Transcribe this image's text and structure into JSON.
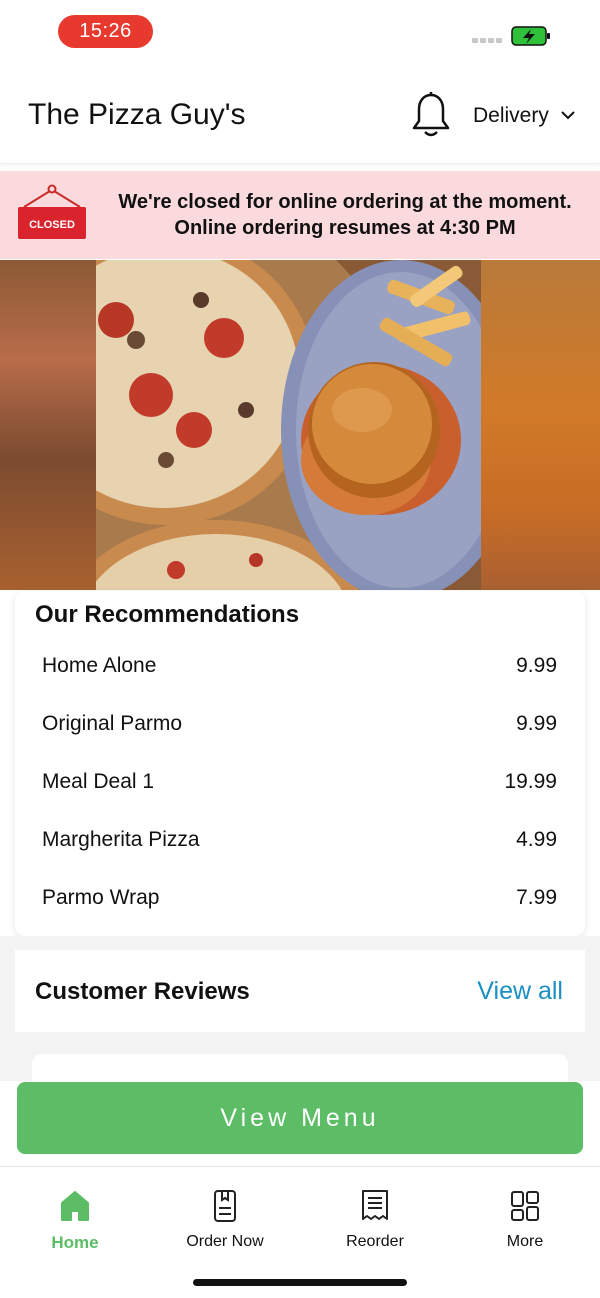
{
  "status_bar": {
    "time": "15:26",
    "battery_color": "#2fc13a",
    "time_pill_color": "#e8392f"
  },
  "header": {
    "title": "The Pizza Guy's",
    "bell_icon": "bell-icon",
    "delivery_label": "Delivery",
    "delivery_chevron": "chevron-down-icon"
  },
  "closed_banner": {
    "sign_text": "CLOSED",
    "line1": "We're closed for online ordering at the moment.",
    "line2": "Online ordering resumes at 4:30 PM",
    "background": "#fadadd"
  },
  "recommendations": {
    "title": "Our Recommendations",
    "items": [
      {
        "name": "Home Alone",
        "price": "9.99"
      },
      {
        "name": "Original Parmo",
        "price": "9.99"
      },
      {
        "name": "Meal Deal 1",
        "price": "19.99"
      },
      {
        "name": "Margherita Pizza",
        "price": "4.99"
      },
      {
        "name": "Parmo Wrap",
        "price": "7.99"
      }
    ]
  },
  "reviews": {
    "title": "Customer Reviews",
    "view_all": "View all",
    "link_color": "#1a8fc2"
  },
  "view_menu_button": {
    "label": "View Menu",
    "color": "#5cbd66"
  },
  "bottom_nav": {
    "active_color": "#5cbd66",
    "items": [
      {
        "label": "Home",
        "icon": "home-icon",
        "active": true
      },
      {
        "label": "Order Now",
        "icon": "order-note-icon",
        "active": false
      },
      {
        "label": "Reorder",
        "icon": "receipt-icon",
        "active": false
      },
      {
        "label": "More",
        "icon": "grid-icon",
        "active": false
      }
    ]
  }
}
